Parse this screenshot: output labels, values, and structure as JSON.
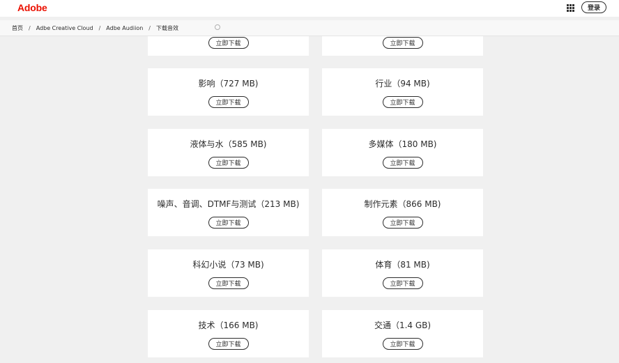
{
  "header": {
    "logo": "Adobe",
    "signin_label": "登录"
  },
  "breadcrumb": [
    "首页",
    "Adbe Creative Cloud",
    "Adbe Audiion",
    "下载音效"
  ],
  "download_label": "立即下载",
  "cards": [
    {
      "title": ""
    },
    {
      "title": ""
    },
    {
      "title": "影响（727 MB)"
    },
    {
      "title": "行业（94 MB)"
    },
    {
      "title": "液体与水（585 MB)"
    },
    {
      "title": "多媒体（180 MB)"
    },
    {
      "title": "噪声、音调、DTMF与测试（213 MB)"
    },
    {
      "title": "制作元素（866 MB)"
    },
    {
      "title": "科幻小说（73 MB)"
    },
    {
      "title": "体育（81 MB)"
    },
    {
      "title": "技术（166 MB)"
    },
    {
      "title": "交通（1.4 GB)"
    }
  ],
  "colors": {
    "brand": "#eb1000",
    "page_bg": "#f0f0f0",
    "card_bg": "#ffffff",
    "text": "#2c2c2c"
  }
}
